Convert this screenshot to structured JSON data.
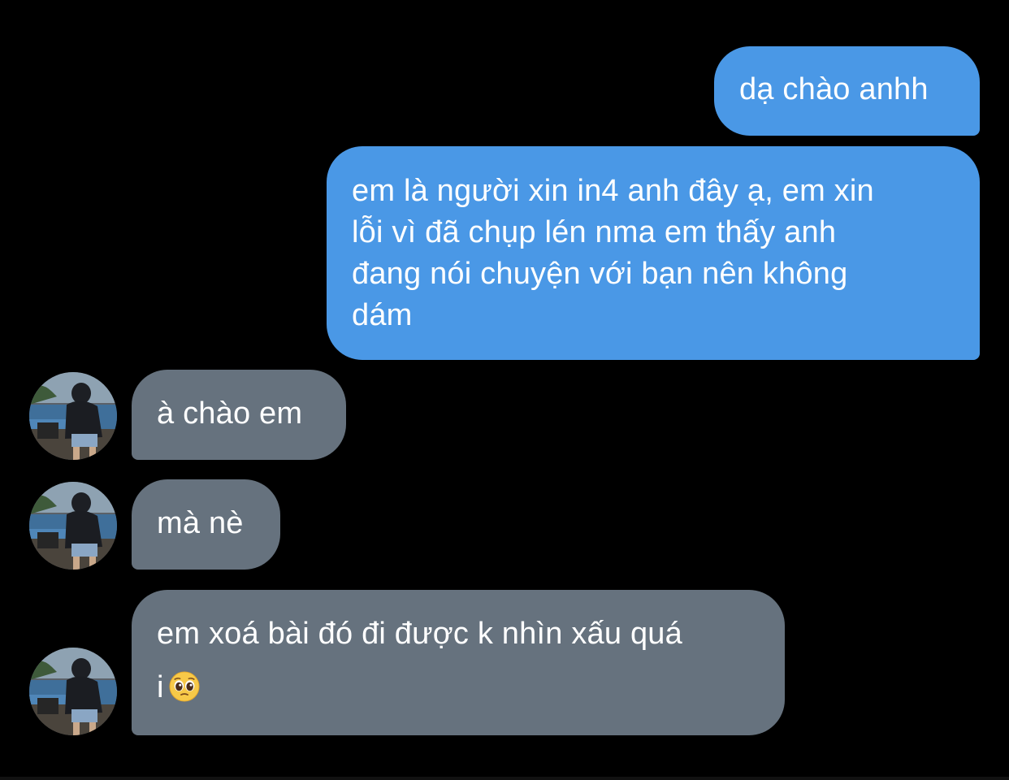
{
  "colors": {
    "background": "#000000",
    "outgoing_bubble": "#4a98e6",
    "incoming_bubble": "#66727e",
    "text": "#ffffff"
  },
  "conversation": {
    "messages": [
      {
        "direction": "outgoing",
        "lines": [
          "dạ chào anhh"
        ]
      },
      {
        "direction": "outgoing",
        "lines": [
          "em là người xin in4 anh đây ạ, em xin",
          "lỗi vì đã chụp lén nma em thấy anh",
          "đang nói chuyện với bạn nên không",
          "dám"
        ]
      },
      {
        "direction": "incoming",
        "lines": [
          "à chào em"
        ],
        "avatar": "contact-avatar"
      },
      {
        "direction": "incoming",
        "lines": [
          "mà nè"
        ],
        "avatar": "contact-avatar"
      },
      {
        "direction": "incoming",
        "lines": [
          "em xoá bài đó đi được k nhìn xấu quá",
          "i"
        ],
        "trailing_emoji": "pleading-face-emoji",
        "avatar": "contact-avatar"
      }
    ]
  }
}
